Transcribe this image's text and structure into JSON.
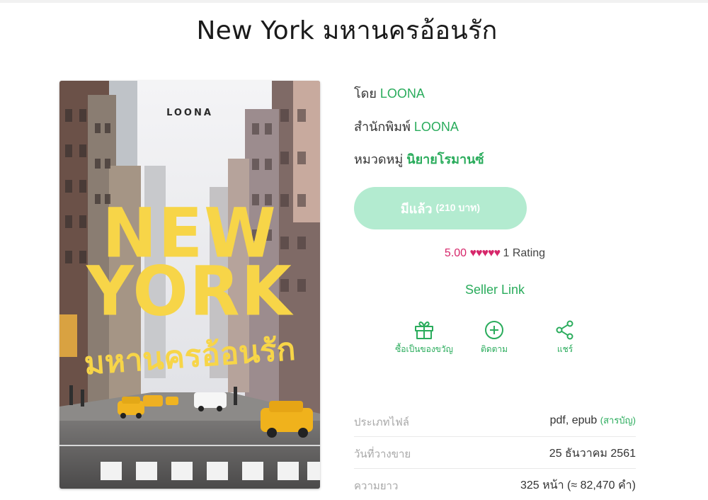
{
  "book": {
    "title": "New York มหานครอ้อนรัก",
    "cover": {
      "author_mark": "LOONA",
      "line1": "NEW",
      "line2": "YORK",
      "thai_title": "มหานครอ้อนรัก"
    }
  },
  "meta": {
    "author_label": "โดย",
    "author": "LOONA",
    "publisher_label": "สำนักพิมพ์",
    "publisher": "LOONA",
    "category_label": "หมวดหมู่",
    "category": "นิยายโรมานซ์"
  },
  "purchase": {
    "owned_label": "มีแล้ว",
    "price": "(210 บาท)"
  },
  "rating": {
    "score": "5.00",
    "hearts": "♥♥♥♥♥",
    "count_text": "1 Rating"
  },
  "seller_link": "Seller Link",
  "actions": {
    "gift": "ซื้อเป็นของขวัญ",
    "follow": "ติดตาม",
    "share": "แชร์"
  },
  "details": {
    "file_type_label": "ประเภทไฟล์",
    "file_type": "pdf, epub",
    "toc": "(สารบัญ)",
    "release_label": "วันที่วางขาย",
    "release": "25 ธันวาคม 2561",
    "length_label": "ความยาว",
    "length": "325 หน้า (≈ 82,470 คำ)"
  },
  "colors": {
    "accent": "#2aac5c",
    "button_bg": "#b3ebd0",
    "rating": "#d6266a",
    "cover_title": "#f7d548"
  }
}
